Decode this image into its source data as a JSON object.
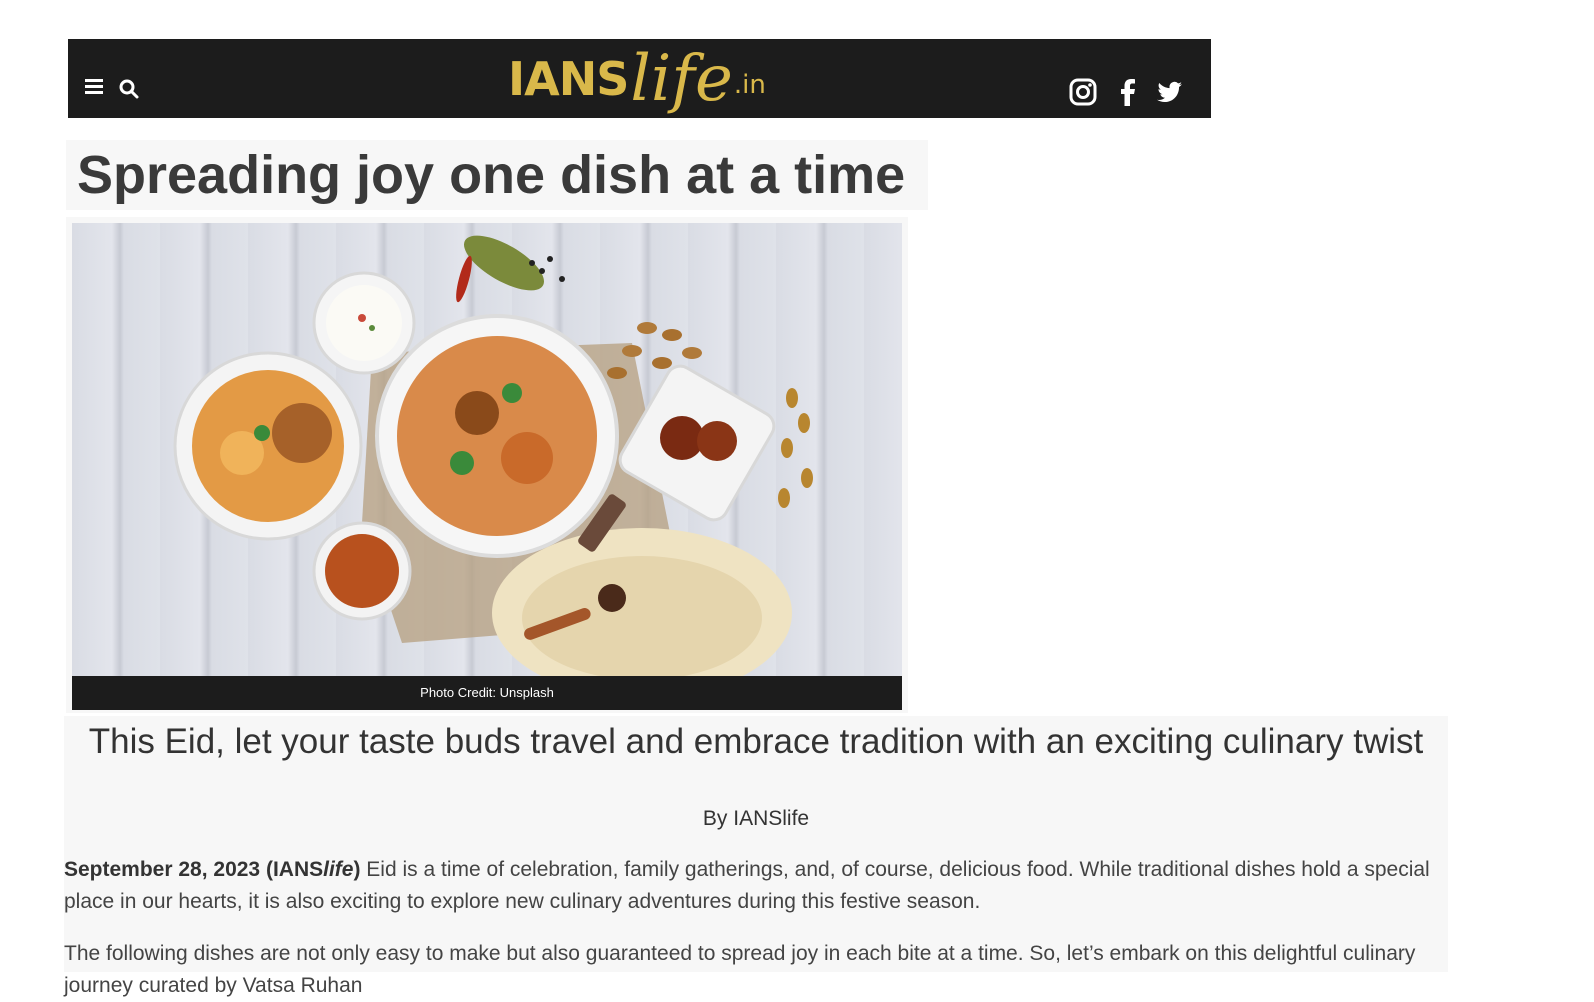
{
  "header": {
    "logo": {
      "part1": "IANS",
      "part2": "life",
      "part3": ".in"
    },
    "icons": [
      "menu-icon",
      "search-icon",
      "instagram-icon",
      "facebook-icon",
      "twitter-icon"
    ]
  },
  "article": {
    "title": "Spreading joy one dish at a time",
    "image_credit": "Photo Credit: Unsplash",
    "subtitle": "This Eid, let your taste buds travel and embrace tradition with an exciting culinary twist",
    "byline": "By IANSlife",
    "dateline": {
      "date": "September 28, 2023 (IANS",
      "brand_italic": "life",
      "close": ")"
    },
    "paragraph1_text": " Eid is a time of celebration, family gatherings, and, of course, delicious food. While traditional dishes hold a special place in our hearts, it is also exciting to explore new culinary adventures during this festive season.",
    "paragraph2_text": "The following dishes are not only easy to make but also guaranteed to spread joy in each bite at a time. So, let’s embark on this delightful culinary journey curated by Vatsa Ruhan"
  },
  "colors": {
    "topbar": "#1c1c1c",
    "logo_gold": "#d9b84a",
    "panel_bg": "#f7f7f7",
    "text": "#333333"
  }
}
